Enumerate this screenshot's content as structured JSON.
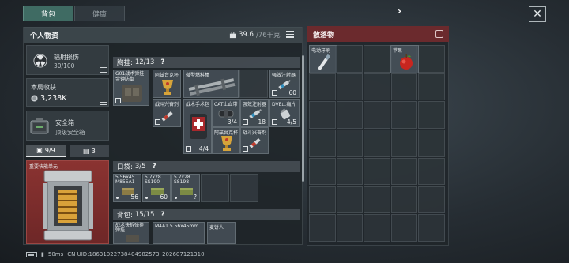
{
  "tabs": [
    {
      "label": "背包",
      "active": true
    },
    {
      "label": "健康",
      "active": false
    }
  ],
  "header": {
    "title": "个人物资",
    "weight_current": "39.6",
    "weight_max": "/76千克"
  },
  "side": {
    "radiation": {
      "label": "辐射损伤",
      "value": "30/100"
    },
    "income": {
      "label": "本局收获",
      "value": "3,238K"
    },
    "safe": {
      "label": "安全箱",
      "sub": "顶级安全箱"
    },
    "pills": [
      {
        "label": "9/9",
        "icon": "briefcase-icon",
        "active": true
      },
      {
        "label": "3",
        "icon": "case-icon",
        "active": false
      }
    ],
    "safe_item_label": "重要快能单元"
  },
  "sections": {
    "rig": {
      "label": "胸挂:",
      "count": "12/13",
      "help": "?"
    },
    "pocket": {
      "label": "口袋:",
      "count": "3/5",
      "help": "?"
    },
    "backpack": {
      "label": "背包:",
      "count": "15/15",
      "help": "?"
    }
  },
  "rig_items": [
    {
      "label": "G01战术弹挂 金钟防御",
      "count": ""
    },
    {
      "label": "阿兹台克杯",
      "count": ""
    },
    {
      "label": "微型燃料棒",
      "count": ""
    },
    {
      "label": "强效注射器",
      "count": "60"
    },
    {
      "label": "战斗兴奋剂",
      "count": ""
    },
    {
      "label": "战术手术包",
      "count": "4/4"
    },
    {
      "label": "CAT止血带",
      "count": "3/4"
    },
    {
      "label": "阿兹台克杯",
      "count": ""
    },
    {
      "label": "强效注射器",
      "count": "18"
    },
    {
      "label": "战斗兴奋剂",
      "count": ""
    },
    {
      "label": "DVE止痛片",
      "count": "4/5"
    }
  ],
  "pocket_items": [
    {
      "label": "5.56x45 M855A1",
      "count": "56"
    },
    {
      "label": "5.7x28 SS190",
      "count": "60"
    },
    {
      "label": "5.7x28 SS198",
      "count": "?"
    }
  ],
  "backpack_items": [
    {
      "label": "战术快拆弹挂 弹挂",
      "count": ""
    },
    {
      "label": "M4A1 5.56x45mm",
      "count": ""
    },
    {
      "label": "麦饼人",
      "count": ""
    }
  ],
  "loot": {
    "title": "散落物",
    "items": [
      {
        "label": "电动牙刷",
        "icon": "toothbrush-icon"
      },
      {
        "label": "苹果",
        "icon": "apple-icon"
      }
    ]
  },
  "footer": {
    "ping": "50ms",
    "uid": "CN UID:186310227384049825​73_202607121310"
  },
  "colors": {
    "accent_tab": "#3f6b63",
    "loot_header": "#6b2a2d",
    "safe_box": "#8a3331"
  }
}
